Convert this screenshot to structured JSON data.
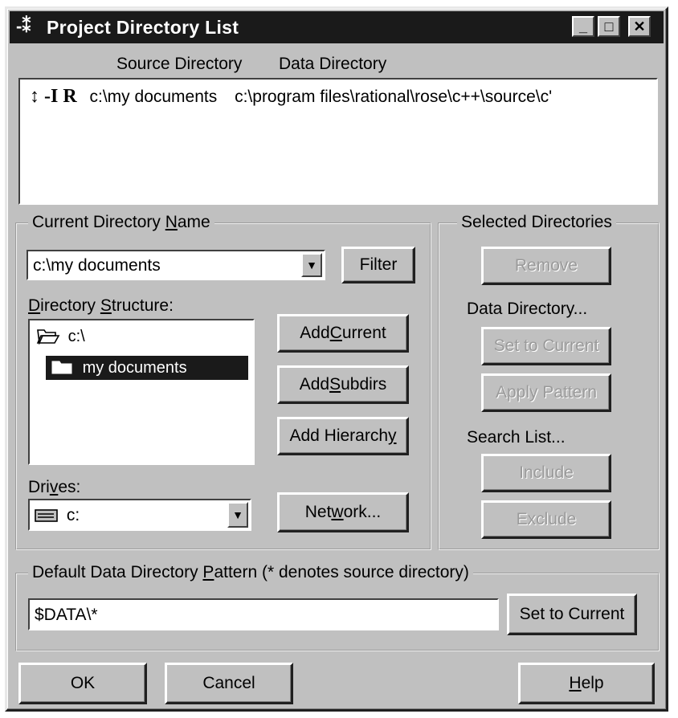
{
  "window": {
    "title": "Project Directory List",
    "title_icon": "directory-list-icon",
    "minimize_glyph": "_",
    "maximize_glyph": "□",
    "close_glyph": "✕"
  },
  "list_header": {
    "source_col": "Source Directory",
    "data_col": "Data Directory"
  },
  "project_list": [
    {
      "flags": "↕ -I R",
      "source": "c:\\my documents",
      "data": "c:\\program files\\rational\\rose\\c++\\source\\c'"
    }
  ],
  "current_dir": {
    "group_label_pre": "Current Directory ",
    "group_label_u": "N",
    "group_label_post": "ame",
    "value": "c:\\my documents",
    "filter_label": "Filter"
  },
  "dir_structure": {
    "label_u": "D",
    "label_rest": "irectory ",
    "label_u2": "S",
    "label_rest2": "tructure:",
    "items": [
      {
        "name": "c:\\",
        "icon": "open-folder-icon",
        "selected": false
      },
      {
        "name": "my documents",
        "icon": "folder-icon",
        "selected": true
      }
    ]
  },
  "buttons": {
    "add_current_pre": "Add ",
    "add_current_u": "C",
    "add_current_post": "urrent",
    "add_subdirs_pre": "Add ",
    "add_subdirs_u": "S",
    "add_subdirs_post": "ubdirs",
    "add_hierarchy_pre": "Add Hierarch",
    "add_hierarchy_u": "y",
    "network_pre": "Net",
    "network_u": "w",
    "network_post": "ork..."
  },
  "drives": {
    "label_pre": "Dri",
    "label_u": "v",
    "label_post": "es:",
    "value": "c:",
    "icon": "drive-icon"
  },
  "selected_dirs": {
    "group_label": "Selected Directories",
    "remove_label": "Remove",
    "data_dir_label": "Data Directory...",
    "set_to_current_label": "Set to Current",
    "apply_pattern_label": "Apply Pattern",
    "search_list_label": "Search List...",
    "include_label": "Include",
    "exclude_label": "Exclude"
  },
  "pattern": {
    "group_label_pre": "Default Data Directory ",
    "group_label_u": "P",
    "group_label_post": "attern  (* denotes source directory)",
    "value": "$DATA\\*",
    "set_to_current_label": "Set to Current"
  },
  "footer": {
    "ok_label": "OK",
    "cancel_label": "Cancel",
    "help_u": "H",
    "help_post": "elp"
  }
}
